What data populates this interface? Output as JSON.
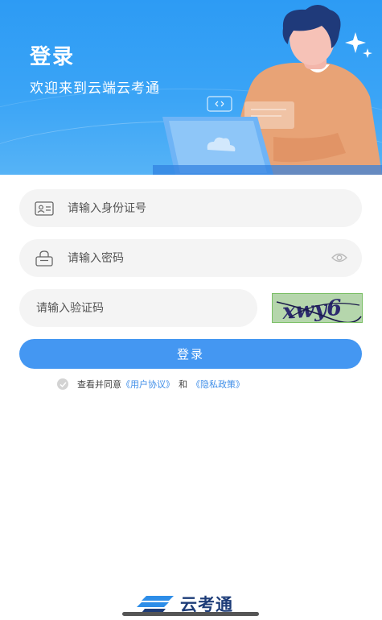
{
  "header": {
    "title": "登录",
    "subtitle": "欢迎来到云端云考通"
  },
  "form": {
    "id_placeholder": "请输入身份证号",
    "password_placeholder": "请输入密码",
    "captcha_placeholder": "请输入验证码",
    "captcha_text": "xwy6",
    "login_label": "登录"
  },
  "agreement": {
    "prefix": "查看并同意",
    "user_agreement": "《用户协议》",
    "and": "和",
    "privacy_policy": "《隐私政策》"
  },
  "footer": {
    "app_name": "云考通"
  },
  "colors": {
    "brand": "#2d9bf4",
    "button": "#4497f2",
    "link": "#3f8ee8"
  }
}
